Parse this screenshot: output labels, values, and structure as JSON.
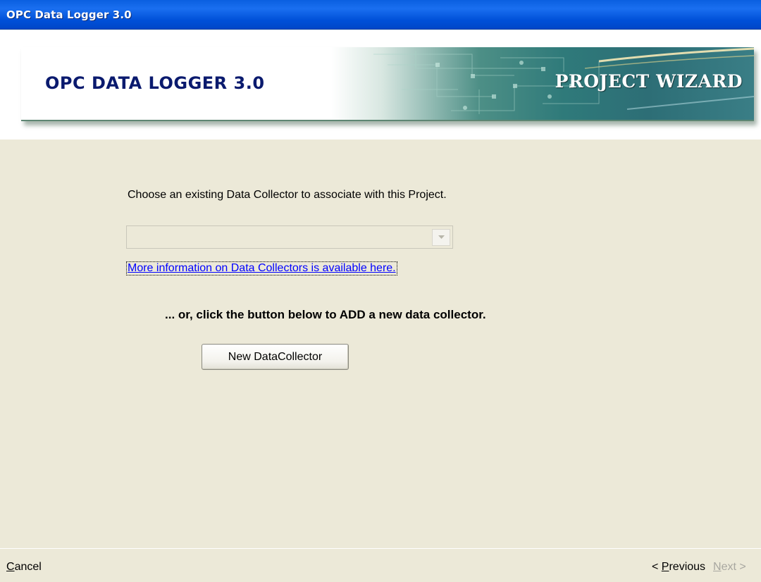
{
  "window": {
    "title": "OPC Data Logger 3.0"
  },
  "banner": {
    "title": "OPC DATA LOGGER 3.0",
    "subtitle": "PROJECT WIZARD"
  },
  "main": {
    "prompt": "Choose an existing Data Collector to associate with this Project.",
    "collector_select": {
      "value": "",
      "enabled": false
    },
    "info_link": "More information on Data Collectors is available here.",
    "or_text": "... or, click the button below to ADD a new data collector.",
    "new_button": "New DataCollector"
  },
  "footer": {
    "cancel": {
      "mnemonic": "C",
      "rest": "ancel"
    },
    "previous": {
      "prefix": "< ",
      "mnemonic": "P",
      "rest": "revious"
    },
    "next": {
      "mnemonic": "N",
      "rest": "ext >",
      "enabled": false
    }
  },
  "colors": {
    "titlebar": "#0A5FE0",
    "face": "#ECE9D8",
    "banner_title": "#0a1a6e",
    "link": "#0000ff",
    "disabled_text": "#a8a7a0"
  }
}
